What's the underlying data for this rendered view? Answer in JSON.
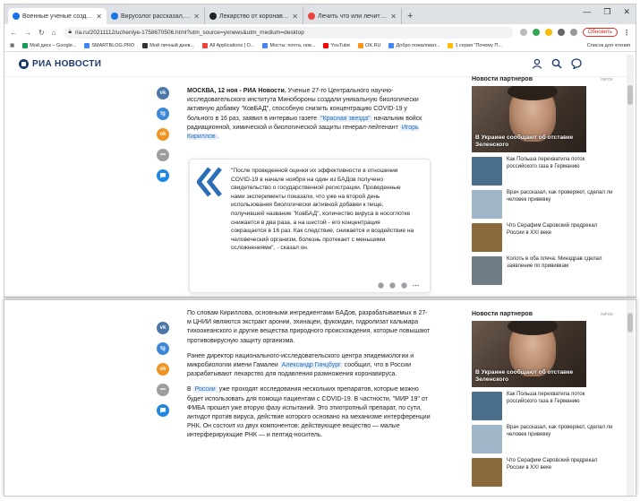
{
  "browser": {
    "tabs": [
      {
        "title": "Военные ученые создали БАД",
        "color": "#1a73e8",
        "active": true
      },
      {
        "title": "Вирусолог рассказал, когда Ро",
        "color": "#1a73e8",
        "active": false
      },
      {
        "title": "Лекарство от коронавируса из",
        "color": "#202124",
        "active": false
      },
      {
        "title": "Лечить что или лечить от чего",
        "color": "#e8453c",
        "active": false
      }
    ],
    "new_tab": "+",
    "url": "ria.ru/20211112/ucheniye-1758670506.html?utm_source=yxnews&utm_medium=desktop",
    "update_label": "Обновить",
    "bookmarks": [
      {
        "label": "Мой диск – Google...",
        "color": "#0f9d58"
      },
      {
        "label": "SMARTBLOG.PRO",
        "color": "#4285f4"
      },
      {
        "label": "Мой личный днев...",
        "color": "#333333"
      },
      {
        "label": "All Applications | O...",
        "color": "#e8453c"
      },
      {
        "label": "Мосты: почта, нов...",
        "color": "#4285f4"
      },
      {
        "label": "YouTube",
        "color": "#ff0000"
      },
      {
        "label": "OK.RU",
        "color": "#f7931e"
      },
      {
        "label": "Добро пожаловат...",
        "color": "#4285f4"
      },
      {
        "label": "1 серия \"Почему П...",
        "color": "#fbbc05"
      }
    ],
    "bookmarks_other": "Список для чтения"
  },
  "site": {
    "logo": "РИА НОВОСТИ"
  },
  "article_top": {
    "dateline": "МОСКВА, 12 ноя - РИА Новости.",
    "p1_a": "Ученые 27-го Центрального научно-исследовательского института Минобороны создали уникальную биологически активную добавку \"КовБАД\", способную снизить концентрацию COVID-19 у больного в 16 раз, заявил в интервью газете",
    "p1_link": "\"Красная звезда\"",
    "p1_b": "начальник войск радиационной, химической и биологической защиты генерал-лейтенант",
    "p1_link2": "Игорь Кириллов",
    "p1_end": ".",
    "quote": "\"После проведенной оценки их эффективности в отношении COVID-19 в начале ноября на один из БАДов получено свидетельство о государственной регистрации. Проведенные нами эксперименты показали, что уже на второй день использования биологически активной добавки к пище, получившей название \"КовБАД\", количество вируса в носоглотке снижается в два раза, а на шестой - его концентрация сокращается в 16 раз. Как следствие, снижается и воздействие на человеческий организм, болезнь протекает с меньшими осложнениями\", - сказал он."
  },
  "article_bottom": {
    "p2": "По словам Кириллова, основными ингредиентами БАДов, разрабатываемых в 27-м ЦНИИ являются экстракт аронии, эхинацеи, фукоидан, гидролизат кальмара тихоокеанского и другие вещества природного происхождения, которые повышают противовирусную защиту организма.",
    "p3_a": "Ранее директор национального-исследовательского центра эпидемиологии и микробиологии имени Гамалеи",
    "p3_link": "Александр Гинцбург",
    "p3_b": "сообщил, что в России разрабатывают лекарство для подавления размножения коронавируса.",
    "p4_pre": "В",
    "p4_link": "России",
    "p4_b": "уже проходят исследования нескольких препаратов, которые можно будет использовать для помощи пациентам с COVID-19. В частности, \"МИР 19\" от ФМБА прошел уже вторую фазу испытаний. Это этиотропный препарат, по сути, антидот против вируса, действие которого основано на механизме интерференции РНК. Он состоит из двух компонентов: действующее вещество — малые интерферирующие РНК — и пептид-носитель."
  },
  "partners": {
    "heading": "Новости партнеров",
    "tag": "INFOX",
    "hero_caption": "В Украине сообщают об отставке Зеленского",
    "items": [
      {
        "text": "Как Польша перехватила поток российского газа в Германию",
        "color": "#4a6f8c"
      },
      {
        "text": "Врач рассказал, как проверяют, сделал ли человек прививку",
        "color": "#9fb6c8"
      },
      {
        "text": "Что Серафим Саровский предрекал России в XXI веке",
        "color": "#8a6a3b"
      },
      {
        "text": "Колоть в оба плеча: Минздрав сделал заявление по прививкам",
        "color": "#6f7d86"
      }
    ]
  },
  "share_buttons": [
    {
      "name": "vk",
      "label": "vk",
      "color": "#4a76a8"
    },
    {
      "name": "telegram",
      "label": "tg",
      "color": "#3d88d6"
    },
    {
      "name": "odnoklassniki",
      "label": "ok",
      "color": "#f29422"
    },
    {
      "name": "more",
      "label": "•••",
      "color": "#9e9e9e"
    },
    {
      "name": "comments",
      "label": "",
      "color": "#1e88e5"
    }
  ]
}
